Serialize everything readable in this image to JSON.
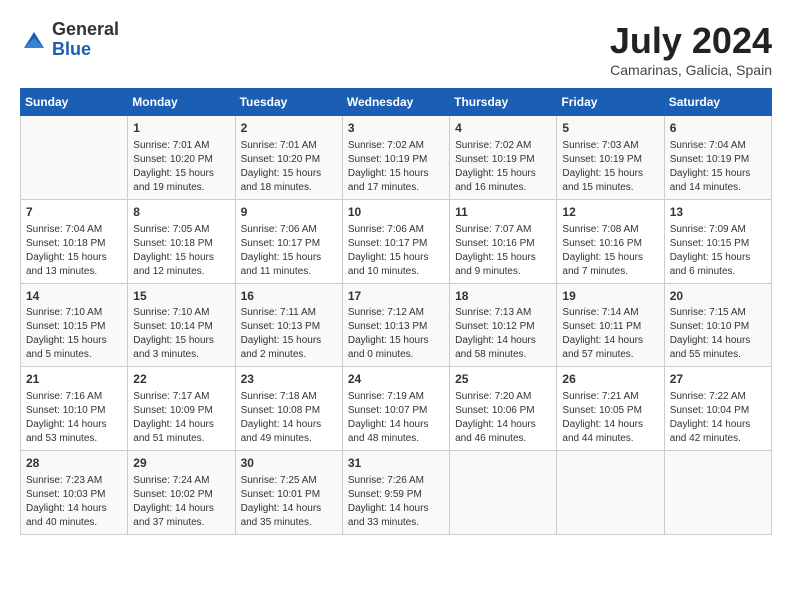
{
  "logo": {
    "general": "General",
    "blue": "Blue"
  },
  "title": {
    "month_year": "July 2024",
    "location": "Camarinas, Galicia, Spain"
  },
  "weekdays": [
    "Sunday",
    "Monday",
    "Tuesday",
    "Wednesday",
    "Thursday",
    "Friday",
    "Saturday"
  ],
  "weeks": [
    [
      {
        "day": "",
        "info": ""
      },
      {
        "day": "1",
        "info": "Sunrise: 7:01 AM\nSunset: 10:20 PM\nDaylight: 15 hours\nand 19 minutes."
      },
      {
        "day": "2",
        "info": "Sunrise: 7:01 AM\nSunset: 10:20 PM\nDaylight: 15 hours\nand 18 minutes."
      },
      {
        "day": "3",
        "info": "Sunrise: 7:02 AM\nSunset: 10:19 PM\nDaylight: 15 hours\nand 17 minutes."
      },
      {
        "day": "4",
        "info": "Sunrise: 7:02 AM\nSunset: 10:19 PM\nDaylight: 15 hours\nand 16 minutes."
      },
      {
        "day": "5",
        "info": "Sunrise: 7:03 AM\nSunset: 10:19 PM\nDaylight: 15 hours\nand 15 minutes."
      },
      {
        "day": "6",
        "info": "Sunrise: 7:04 AM\nSunset: 10:19 PM\nDaylight: 15 hours\nand 14 minutes."
      }
    ],
    [
      {
        "day": "7",
        "info": "Sunrise: 7:04 AM\nSunset: 10:18 PM\nDaylight: 15 hours\nand 13 minutes."
      },
      {
        "day": "8",
        "info": "Sunrise: 7:05 AM\nSunset: 10:18 PM\nDaylight: 15 hours\nand 12 minutes."
      },
      {
        "day": "9",
        "info": "Sunrise: 7:06 AM\nSunset: 10:17 PM\nDaylight: 15 hours\nand 11 minutes."
      },
      {
        "day": "10",
        "info": "Sunrise: 7:06 AM\nSunset: 10:17 PM\nDaylight: 15 hours\nand 10 minutes."
      },
      {
        "day": "11",
        "info": "Sunrise: 7:07 AM\nSunset: 10:16 PM\nDaylight: 15 hours\nand 9 minutes."
      },
      {
        "day": "12",
        "info": "Sunrise: 7:08 AM\nSunset: 10:16 PM\nDaylight: 15 hours\nand 7 minutes."
      },
      {
        "day": "13",
        "info": "Sunrise: 7:09 AM\nSunset: 10:15 PM\nDaylight: 15 hours\nand 6 minutes."
      }
    ],
    [
      {
        "day": "14",
        "info": "Sunrise: 7:10 AM\nSunset: 10:15 PM\nDaylight: 15 hours\nand 5 minutes."
      },
      {
        "day": "15",
        "info": "Sunrise: 7:10 AM\nSunset: 10:14 PM\nDaylight: 15 hours\nand 3 minutes."
      },
      {
        "day": "16",
        "info": "Sunrise: 7:11 AM\nSunset: 10:13 PM\nDaylight: 15 hours\nand 2 minutes."
      },
      {
        "day": "17",
        "info": "Sunrise: 7:12 AM\nSunset: 10:13 PM\nDaylight: 15 hours\nand 0 minutes."
      },
      {
        "day": "18",
        "info": "Sunrise: 7:13 AM\nSunset: 10:12 PM\nDaylight: 14 hours\nand 58 minutes."
      },
      {
        "day": "19",
        "info": "Sunrise: 7:14 AM\nSunset: 10:11 PM\nDaylight: 14 hours\nand 57 minutes."
      },
      {
        "day": "20",
        "info": "Sunrise: 7:15 AM\nSunset: 10:10 PM\nDaylight: 14 hours\nand 55 minutes."
      }
    ],
    [
      {
        "day": "21",
        "info": "Sunrise: 7:16 AM\nSunset: 10:10 PM\nDaylight: 14 hours\nand 53 minutes."
      },
      {
        "day": "22",
        "info": "Sunrise: 7:17 AM\nSunset: 10:09 PM\nDaylight: 14 hours\nand 51 minutes."
      },
      {
        "day": "23",
        "info": "Sunrise: 7:18 AM\nSunset: 10:08 PM\nDaylight: 14 hours\nand 49 minutes."
      },
      {
        "day": "24",
        "info": "Sunrise: 7:19 AM\nSunset: 10:07 PM\nDaylight: 14 hours\nand 48 minutes."
      },
      {
        "day": "25",
        "info": "Sunrise: 7:20 AM\nSunset: 10:06 PM\nDaylight: 14 hours\nand 46 minutes."
      },
      {
        "day": "26",
        "info": "Sunrise: 7:21 AM\nSunset: 10:05 PM\nDaylight: 14 hours\nand 44 minutes."
      },
      {
        "day": "27",
        "info": "Sunrise: 7:22 AM\nSunset: 10:04 PM\nDaylight: 14 hours\nand 42 minutes."
      }
    ],
    [
      {
        "day": "28",
        "info": "Sunrise: 7:23 AM\nSunset: 10:03 PM\nDaylight: 14 hours\nand 40 minutes."
      },
      {
        "day": "29",
        "info": "Sunrise: 7:24 AM\nSunset: 10:02 PM\nDaylight: 14 hours\nand 37 minutes."
      },
      {
        "day": "30",
        "info": "Sunrise: 7:25 AM\nSunset: 10:01 PM\nDaylight: 14 hours\nand 35 minutes."
      },
      {
        "day": "31",
        "info": "Sunrise: 7:26 AM\nSunset: 9:59 PM\nDaylight: 14 hours\nand 33 minutes."
      },
      {
        "day": "",
        "info": ""
      },
      {
        "day": "",
        "info": ""
      },
      {
        "day": "",
        "info": ""
      }
    ]
  ]
}
